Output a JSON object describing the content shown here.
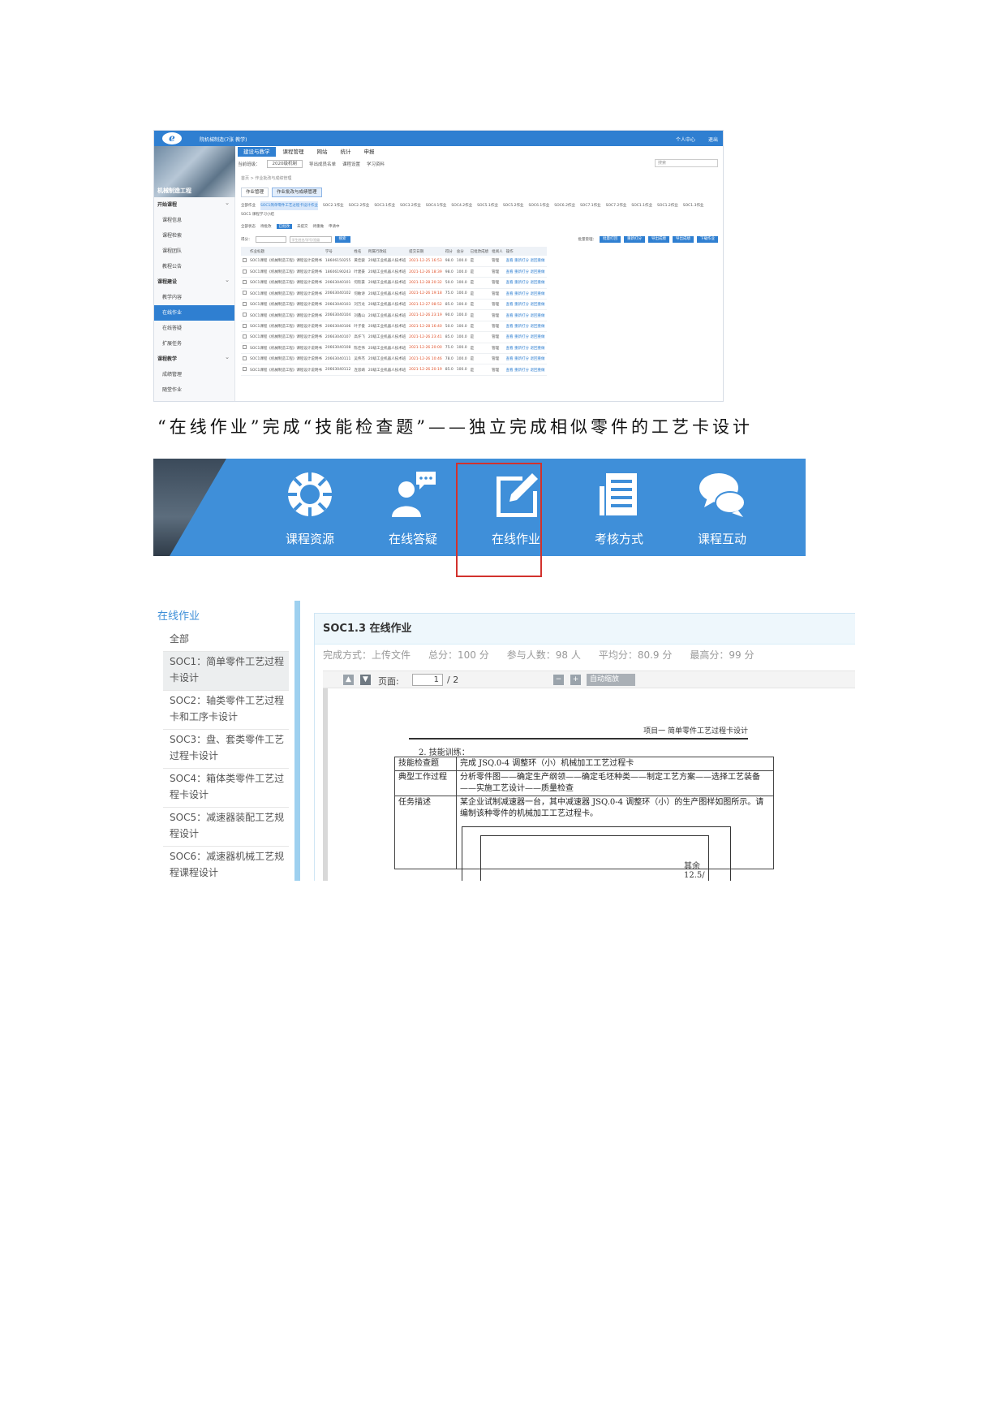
{
  "shot1": {
    "course_name": "院机械制造(7张 教学)",
    "top_right": [
      "个人中心",
      "退出"
    ],
    "side_caption": "机械制造工程",
    "sidebar": [
      {
        "label": "开始课程",
        "group": true
      },
      {
        "label": "课程信息",
        "group": false
      },
      {
        "label": "课程检索",
        "group": false
      },
      {
        "label": "课程团队",
        "group": false
      },
      {
        "label": "教程公告",
        "group": false
      },
      {
        "label": "课程建设",
        "group": true
      },
      {
        "label": "教学内容",
        "group": false
      },
      {
        "label": "在线作业",
        "group": false,
        "active": true
      },
      {
        "label": "在线答疑",
        "group": false
      },
      {
        "label": "扩展任务",
        "group": false
      },
      {
        "label": "课程教学",
        "group": true
      },
      {
        "label": "成绩管理",
        "group": false
      },
      {
        "label": "随堂作业",
        "group": false
      }
    ],
    "nav_tabs": [
      "建设与教学",
      "课程管理",
      "网站",
      "统计",
      "申报"
    ],
    "toolbar": [
      "当前班级：",
      "2020级机制",
      "导出成员名单",
      "课程设置",
      "学习资料"
    ],
    "search_placeholder": "搜索",
    "breadcrumb": "首页 > 作业批改与成绩管理",
    "subtabs": [
      "作业管理",
      "作业批改与成绩管理"
    ],
    "hw_tabs": [
      "全部作业",
      "SOC1简单零件工艺过程卡设计作业",
      "SOC2.1作业",
      "SOC2.2作业",
      "SOC3.1作业",
      "SOC3.2作业",
      "SOC4.1作业",
      "SOC4.2作业",
      "SOC5.1作业",
      "SOC5.2作业",
      "SOC6.1作业",
      "SOC6.2作业",
      "SOC7.1作业",
      "SOC7.2作业",
      "SOC1.1作业",
      "SOC1.2作业",
      "SOC1.3作业",
      "SOC1 课程学习小结"
    ],
    "status_tabs": [
      "全部状态",
      "待批改",
      "已批改",
      "未提交",
      "待重做",
      "申请中"
    ],
    "filter": {
      "label": "得分：",
      "placeholder": "学生姓名/学号/班级",
      "go": "搜索",
      "include_text": "批量管理："
    },
    "actions": [
      "批量打回",
      "重新打分",
      "导出成绩",
      "导出成绩",
      "下载作业"
    ],
    "table_headers": [
      "",
      "作业标题",
      "学号",
      "姓名",
      "所属行政班",
      "提交日期",
      "得分",
      "总分",
      "已批改成绩",
      "批阅人",
      "操作"
    ],
    "rows": [
      [
        "SOC1课程《机械制造工程》课程设计说明书",
        "18606150255",
        "黄佳骏",
        "20级工业机器人技术班",
        "2021-12-25 16:53",
        "98.0",
        "100.0",
        "是",
        "管理",
        "查看 重新打分 退回重做"
      ],
      [
        "SOC1课程《机械制造工程》课程设计说明书",
        "18606190243",
        "叶建豪",
        "20级工业机器人技术班",
        "2021-12-26 18:39",
        "98.0",
        "100.0",
        "是",
        "管理",
        "查看 重新打分 退回重做"
      ],
      [
        "SOC1课程《机械制造工程》课程设计说明书",
        "20663040101",
        "何钦豪",
        "20级工业机器人技术班",
        "2021-12-28 20:32",
        "50.0",
        "100.0",
        "是",
        "管理",
        "查看 重新打分 退回重做"
      ],
      [
        "SOC1课程《机械制造工程》课程设计说明书",
        "20663040102",
        "何敏诗",
        "20级工业机器人技术班",
        "2021-12-26 19:18",
        "75.0",
        "100.0",
        "是",
        "管理",
        "查看 重新打分 退回重做"
      ],
      [
        "SOC1课程《机械制造工程》课程设计说明书",
        "20663040103",
        "刘万龙",
        "20级工业机器人技术班",
        "2021-12-27 08:52",
        "85.0",
        "100.0",
        "是",
        "管理",
        "查看 重新打分 退回重做"
      ],
      [
        "SOC1课程《机械制造工程》课程设计说明书",
        "20663040104",
        "刘鑫山",
        "20级工业机器人技术班",
        "2021-12-26 23:19",
        "90.0",
        "100.0",
        "是",
        "管理",
        "查看 重新打分 退回重做"
      ],
      [
        "SOC1课程《机械制造工程》课程设计说明书",
        "20663040106",
        "叶子俊",
        "20级工业机器人技术班",
        "2021-12-28 16:40",
        "50.0",
        "100.0",
        "是",
        "管理",
        "查看 重新打分 退回重做"
      ],
      [
        "SOC1课程《机械制造工程》课程设计说明书",
        "20663040107",
        "高许飞",
        "20级工业机器人技术班",
        "2021-12-26 23:41",
        "85.0",
        "100.0",
        "是",
        "管理",
        "查看 重新打分 退回重做"
      ],
      [
        "SOC1课程《机械制造工程》课程设计说明书",
        "20663040108",
        "陈佳伟",
        "20级工业机器人技术班",
        "2021-12-26 20:00",
        "75.0",
        "100.0",
        "是",
        "管理",
        "查看 重新打分 退回重做"
      ],
      [
        "SOC1课程《机械制造工程》课程设计说明书",
        "20663040111",
        "吴伟杰",
        "20级工业机器人技术班",
        "2021-12-26 10:46",
        "78.0",
        "100.0",
        "是",
        "管理",
        "查看 重新打分 退回重做"
      ],
      [
        "SOC1课程《机械制造工程》课程设计说明书",
        "20663040112",
        "连思靖",
        "20级工业机器人技术班",
        "2021-12-26 20:19",
        "85.0",
        "100.0",
        "是",
        "管理",
        "查看 重新打分 退回重做"
      ]
    ]
  },
  "caption": "“在线作业”完成“技能检查题”——独立完成相似零件的工艺卡设计",
  "shot2": {
    "items": [
      {
        "label": "课程资源",
        "icon": "lifebuoy-icon"
      },
      {
        "label": "在线答疑",
        "icon": "person-chat-icon"
      },
      {
        "label": "在线作业",
        "icon": "edit-icon",
        "highlighted": true
      },
      {
        "label": "考核方式",
        "icon": "document-icon"
      },
      {
        "label": "课程互动",
        "icon": "chat-bubbles-icon"
      }
    ],
    "highlight_color": "#d2322d"
  },
  "shot3": {
    "side_title": "在线作业",
    "side_items": [
      {
        "label": "全部",
        "active": false
      },
      {
        "label": "SOC1：简单零件工艺过程卡设计",
        "active": true
      },
      {
        "label": "SOC2：轴类零件工艺过程卡和工序卡设计",
        "active": false
      },
      {
        "label": "SOC3：盘、套类零件工艺过程卡设计",
        "active": false
      },
      {
        "label": "SOC4：箱体类零件工艺过程卡设计",
        "active": false
      },
      {
        "label": "SOC5：减速器装配工艺规程设计",
        "active": false
      },
      {
        "label": "SOC6：减速器机械工艺规程课程设计",
        "active": false
      }
    ],
    "panel_title": "SOC1.3 在线作业",
    "stats": [
      "完成方式：上传文件",
      "总分：100 分",
      "参与人数：98 人",
      "平均分：80.9 分",
      "最高分：99 分"
    ],
    "viewer": {
      "page_label": "页面:",
      "page_value": "1",
      "page_total": "/ 2",
      "zoom": "自动缩放"
    },
    "doc": {
      "header": "项目一  简单零件工艺过程卡设计",
      "section": "2. 技能训练：",
      "rows": [
        {
          "label": "技能检查题",
          "text": "完成 JSQ.0-4 调整环（小）机械加工工艺过程卡"
        },
        {
          "label": "典型工作过程",
          "text": "分析零件图——确定生产纲领——确定毛坯种类——制定工艺方案——选择工艺装备——实施工艺设计——质量检查"
        },
        {
          "label": "任务描述",
          "text": "某企业试制减速器一台，其中减速器 JSQ.0-4 调整环（小）的生产图样如图所示。请编制该种零件的机械加工工艺过程卡。"
        }
      ],
      "roughness": "其余 12.5/"
    }
  }
}
